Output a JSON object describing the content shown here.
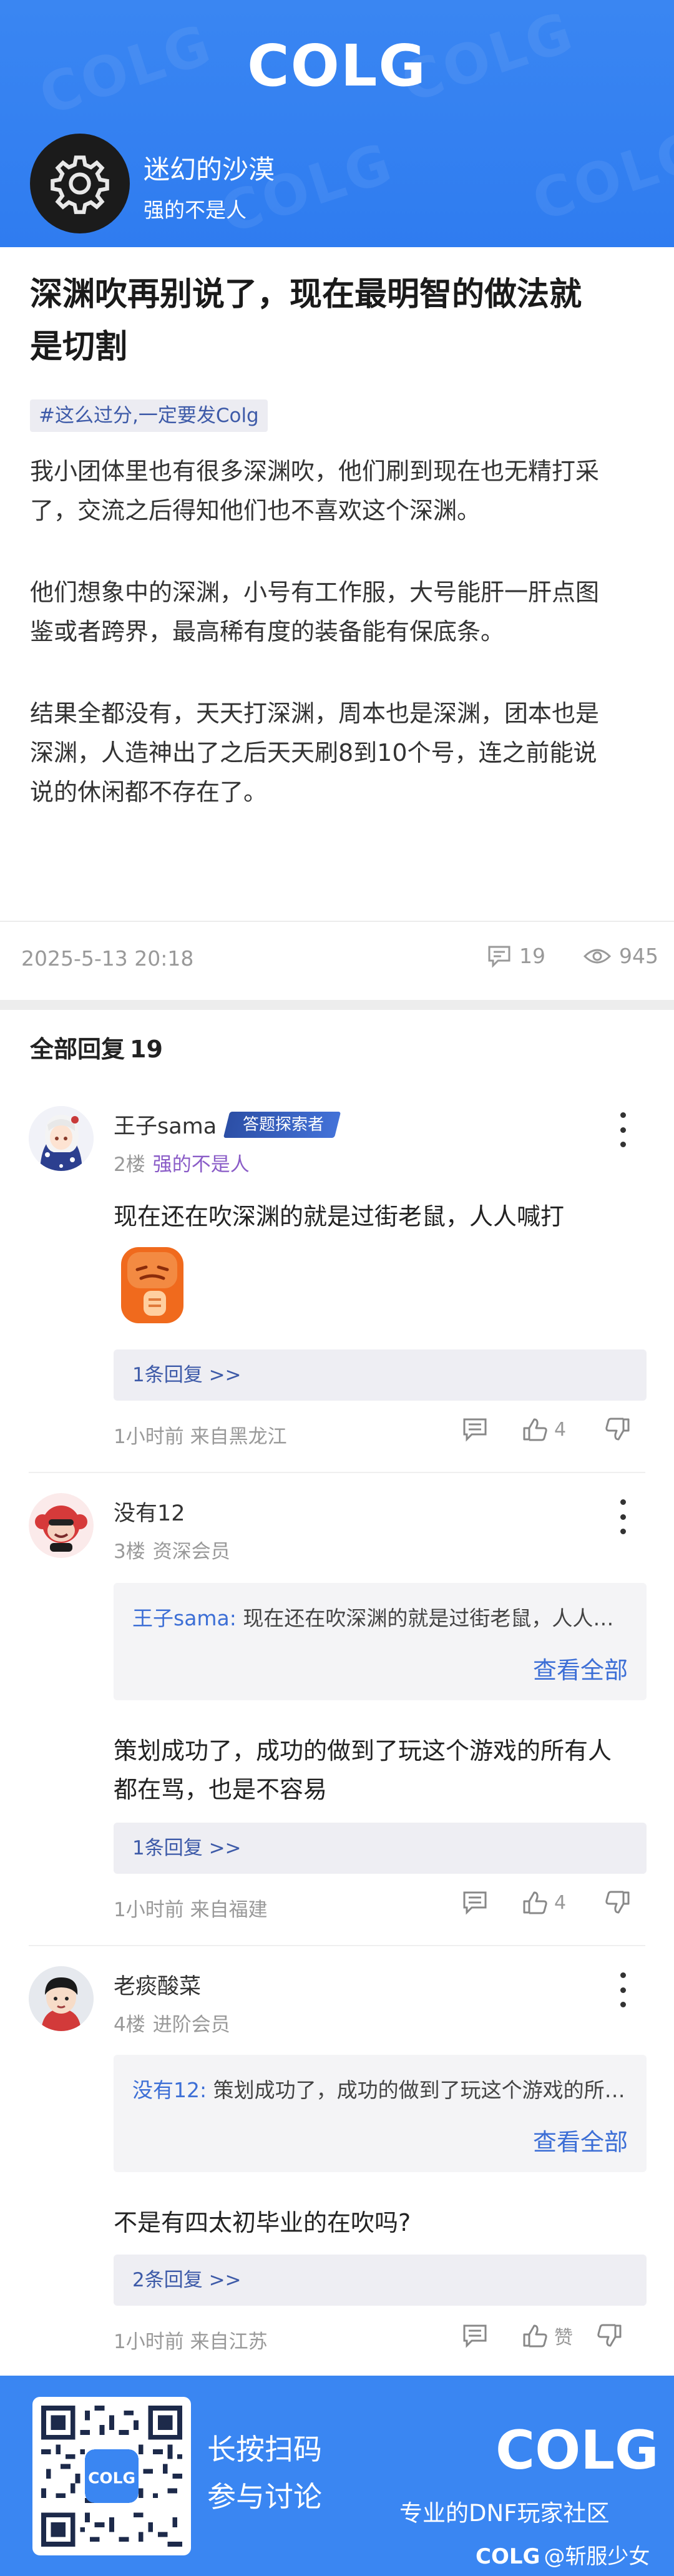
{
  "header": {
    "logo": "COLG",
    "author": {
      "name": "迷幻的沙漠",
      "title": "强的不是人"
    }
  },
  "post": {
    "title": "深渊吹再别说了，现在最明智的做法就是切割",
    "title_line1": "深渊吹再别说了，现在最明智的做法就",
    "title_line2": "是切割",
    "tag": "#这么过分,一定要发Colg",
    "paragraphs": [
      [
        "我小团体里也有很多深渊吹，他们刷到现在也无精打采",
        "了，交流之后得知他们也不喜欢这个深渊。"
      ],
      [
        "他们想象中的深渊，小号有工作服，大号能肝一肝点图",
        "鉴或者跨界，最高稀有度的装备能有保底条。"
      ],
      [
        "结果全都没有，天天打深渊，周本也是深渊，团本也是",
        "深渊，人造神出了之后天天刷8到10个号，连之前能说",
        "说的休闲都不存在了。"
      ]
    ],
    "date": "2025-5-13 20:18",
    "comment_count": "19",
    "view_count": "945"
  },
  "replies_header": {
    "label": "全部回复",
    "count": "19"
  },
  "comments": [
    {
      "user": "王子sama",
      "badge": "答题探索者",
      "floor": "2楼",
      "level": "强的不是人",
      "text": "现在还在吹深渊的就是过街老鼠，人人喊打",
      "reply_label": "1条回复 >>",
      "time": "1小时前 来自黑龙江",
      "likes": "4"
    },
    {
      "user": "没有12",
      "floor": "3楼",
      "level": "资深会员",
      "quote_user": "王子sama:",
      "quote_text": "现在还在吹深渊的就是过街老鼠，人人喊打",
      "quote_all": "查看全部",
      "text_line1": "策划成功了，成功的做到了玩这个游戏的所有人",
      "text_line2": "都在骂，也是不容易",
      "reply_label": "1条回复 >>",
      "time": "1小时前 来自福建",
      "likes": "4"
    },
    {
      "user": "老痰酸菜",
      "floor": "4楼",
      "level": "进阶会员",
      "quote_user": "没有12:",
      "quote_text": "策划成功了，成功的做到了玩这个游戏的所有人都在骂",
      "quote_all": "查看全部",
      "text": "不是有四太初毕业的在吹吗?",
      "reply_label": "2条回复 >>",
      "time": "1小时前 来自江苏",
      "likes": "赞"
    }
  ],
  "footer": {
    "scan_line1": "长按扫码",
    "scan_line2": "参与讨论",
    "logo": "COLG",
    "slogan": "专业的DNF玩家社区",
    "mark_logo": "COLG",
    "mark_text": "@斩服少女"
  },
  "colors": {
    "brand_blue": "#3a86f2",
    "link_blue": "#3d6fd6",
    "level_purple": "#8a5cc7"
  }
}
